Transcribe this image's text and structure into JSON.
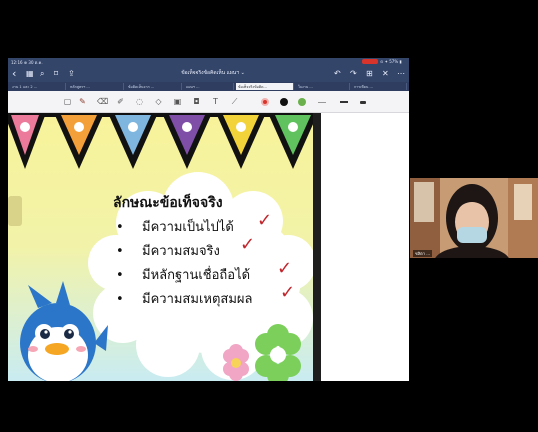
{
  "status_bar": {
    "time": "12:16 ⊕ 30 ต.ค.",
    "right_text": "⊙ ✦ 57% ▮"
  },
  "nav": {
    "back_icon": "chevron-left-icon",
    "doc_title": "ข้อเท็จจริงข้อคิดเห็น แผนฯ ⌄"
  },
  "tabs": [
    {
      "label": "งาน 1 และ 2 ...",
      "active": false
    },
    {
      "label": "หลักสูตรฯ ...",
      "active": false
    },
    {
      "label": "ข้อคิดเห็นจาก ...",
      "active": false
    },
    {
      "label": "แผนฯ ...",
      "active": false
    },
    {
      "label": "ข้อเท็จจริงข้อคิด...",
      "active": true
    },
    {
      "label": "ใบงาน ...",
      "active": false
    },
    {
      "label": "การเขียน ...",
      "active": false
    }
  ],
  "toolbar": {
    "colors": [
      "#d9342b",
      "#111111",
      "#6ab04c"
    ]
  },
  "slide": {
    "heading": "ลักษณะข้อเท็จจริง",
    "bullets": [
      "มีความเป็นไปได้",
      "มีความสมจริง",
      "มีหลักฐานเชื่อถือได้",
      "มีความสมเหตุสมผล"
    ],
    "bullet_symbol": "•",
    "check_symbol": "✓",
    "pennant_colors": [
      "#ec7a9a",
      "#f3a03a",
      "#7fb6e0",
      "#7f4fa8",
      "#f2d33a",
      "#5fc25e"
    ]
  },
  "video": {
    "participant_name": "ชลิตา ..."
  }
}
